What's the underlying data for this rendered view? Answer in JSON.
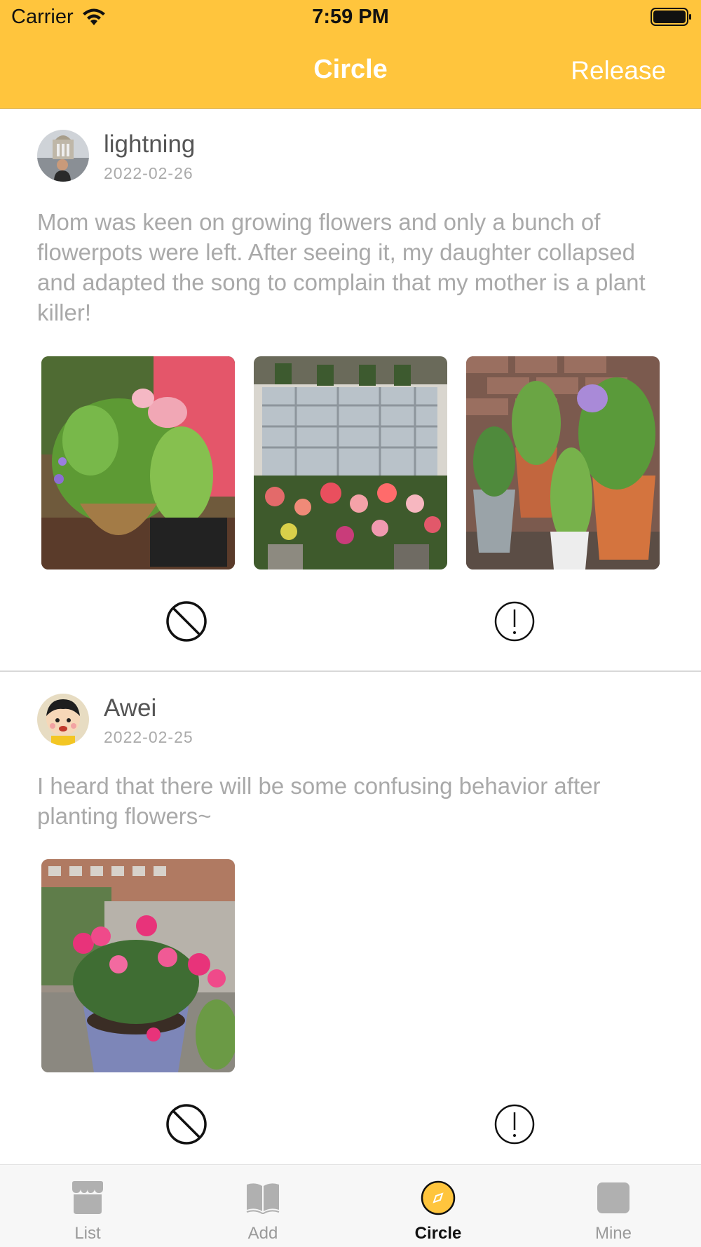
{
  "status_bar": {
    "carrier": "Carrier",
    "time": "7:59 PM"
  },
  "nav": {
    "title": "Circle",
    "release": "Release"
  },
  "posts": [
    {
      "username": "lightning",
      "date": "2022-02-26",
      "text": "Mom was keen on growing flowers and only a bunch of flowerpots were left. After seeing it, my daughter collapsed and adapted the song to complain that my mother is a plant killer!",
      "image_count": 3
    },
    {
      "username": "Awei",
      "date": "2022-02-25",
      "text": "I heard that there will be some confusing behavior after planting flowers~",
      "image_count": 1
    }
  ],
  "tabbar": {
    "items": [
      {
        "label": "List",
        "icon": "store-icon"
      },
      {
        "label": "Add",
        "icon": "book-icon"
      },
      {
        "label": "Circle",
        "icon": "compass-icon"
      },
      {
        "label": "Mine",
        "icon": "person-icon"
      }
    ],
    "active": "Circle"
  },
  "colors": {
    "accent": "#FFC53D",
    "header_text": "#FFFFFF",
    "body_text": "#A9A9A9",
    "username": "#555555",
    "tab_inactive": "#9A9A9A",
    "tab_active": "#111111"
  }
}
